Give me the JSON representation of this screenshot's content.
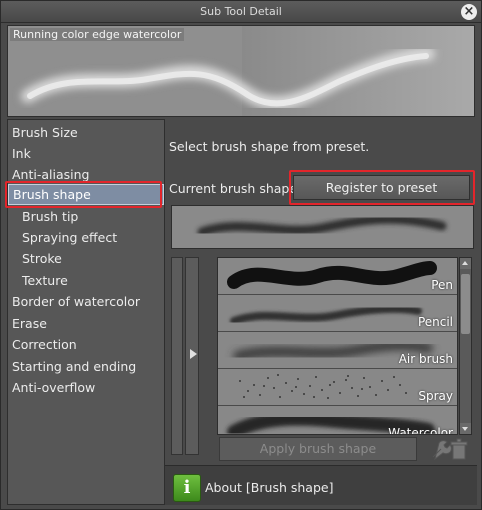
{
  "window": {
    "title": "Sub Tool Detail"
  },
  "preview": {
    "label": "Running color edge watercolor"
  },
  "sidebar": {
    "items": [
      {
        "label": "Brush Size",
        "sub": false
      },
      {
        "label": "Ink",
        "sub": false
      },
      {
        "label": "Anti-aliasing",
        "sub": false
      },
      {
        "label": "Brush shape",
        "sub": false,
        "selected": true
      },
      {
        "label": "Brush tip",
        "sub": true
      },
      {
        "label": "Spraying effect",
        "sub": true
      },
      {
        "label": "Stroke",
        "sub": true
      },
      {
        "label": "Texture",
        "sub": true
      },
      {
        "label": "Border of watercolor",
        "sub": false
      },
      {
        "label": "Erase",
        "sub": false
      },
      {
        "label": "Correction",
        "sub": false
      },
      {
        "label": "Starting and ending",
        "sub": false
      },
      {
        "label": "Anti-overflow",
        "sub": false
      }
    ]
  },
  "main": {
    "instruction": "Select brush shape from preset.",
    "current_label": "Current brush shape",
    "register_label": "Register to preset",
    "apply_label": "Apply brush shape"
  },
  "brushes": [
    {
      "name": "Pen"
    },
    {
      "name": "Pencil"
    },
    {
      "name": "Air brush"
    },
    {
      "name": "Spray"
    },
    {
      "name": "Watercolor"
    }
  ],
  "about": {
    "text": "About [Brush shape]"
  },
  "colors": {
    "highlight": "#e3252b",
    "selected_bg": "#7e8da3",
    "info_green": "#4f9e28"
  }
}
